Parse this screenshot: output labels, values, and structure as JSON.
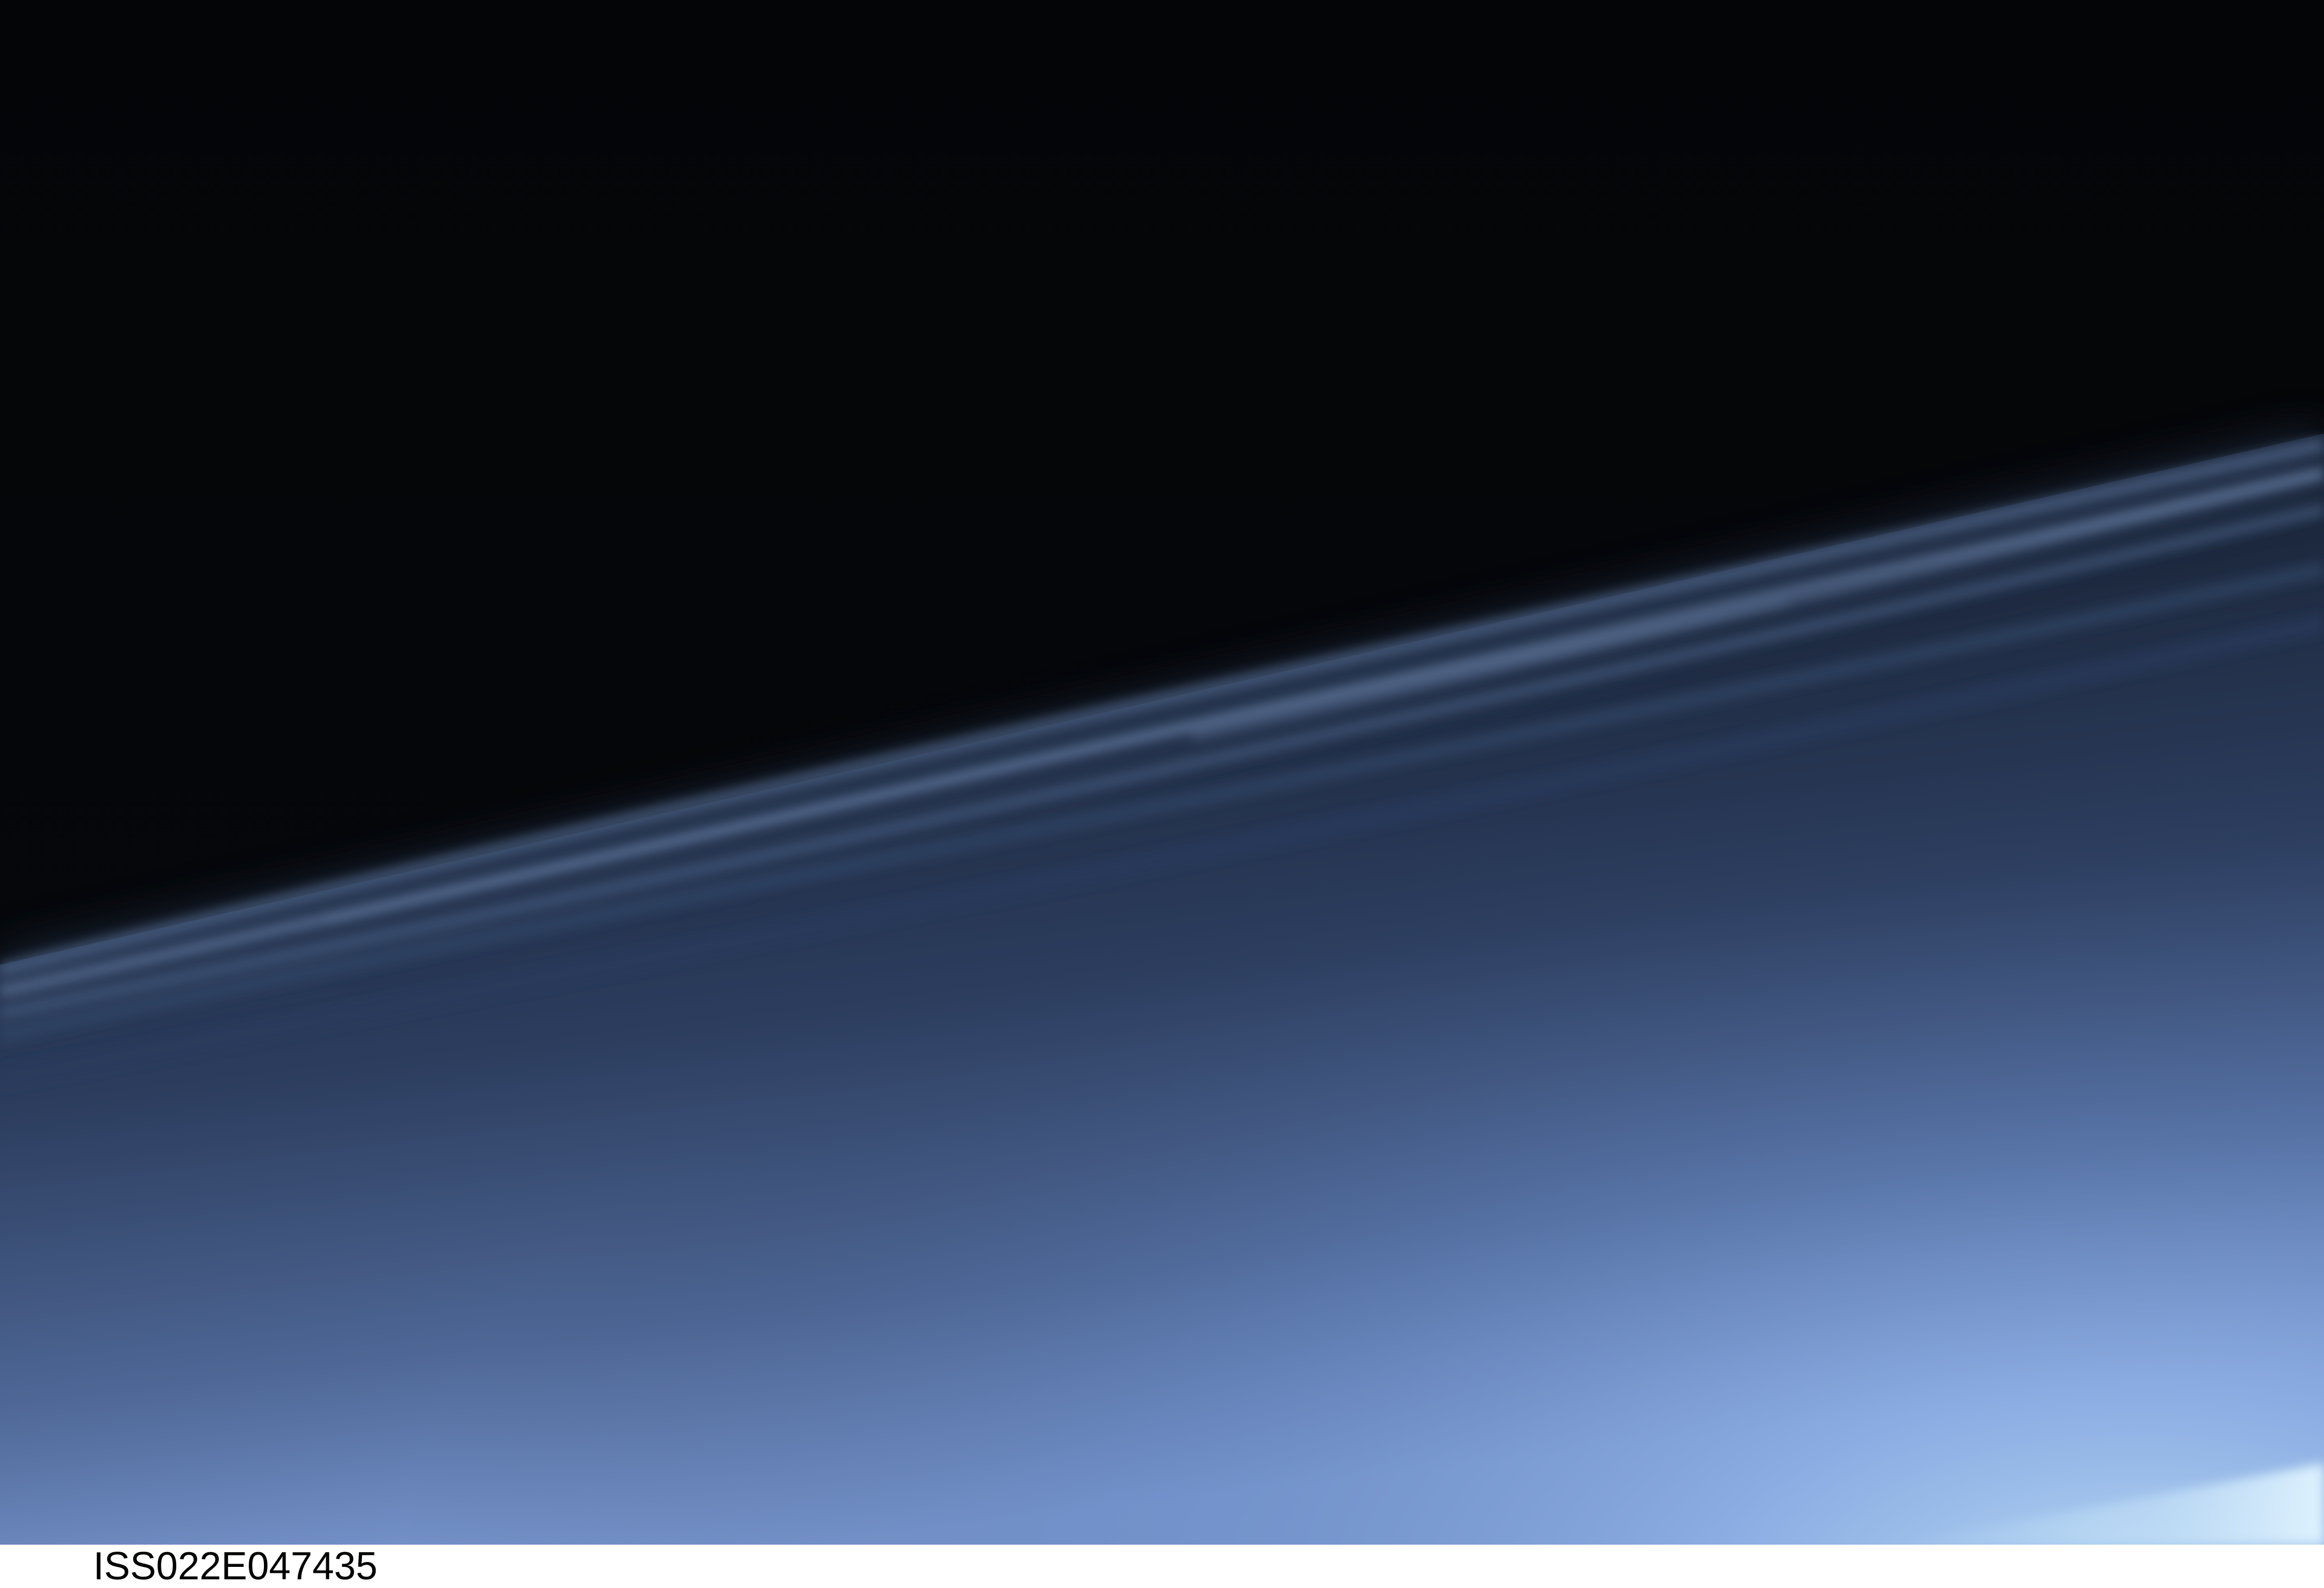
{
  "photo": {
    "id_label": "ISS022E047435",
    "subject": "earth-limb-with-noctilucent-clouds",
    "colors": {
      "space": "#050608",
      "cloud_band": "#5d7396",
      "lower_atmosphere": "#1a2538",
      "horizon_glow": "#8fb1e6",
      "horizon_bright": "#cfe9fb"
    }
  }
}
